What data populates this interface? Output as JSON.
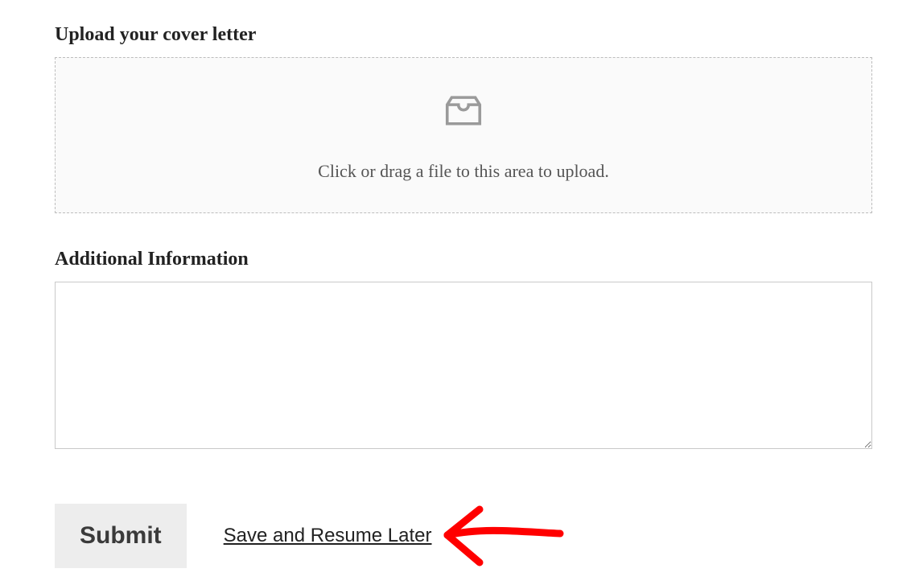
{
  "cover_letter": {
    "label": "Upload your cover letter",
    "dropzone_text": "Click or drag a file to this area to upload."
  },
  "additional": {
    "label": "Additional Information",
    "value": ""
  },
  "actions": {
    "submit_label": "Submit",
    "save_resume_label": "Save and Resume Later"
  },
  "annotation": {
    "arrow_color": "#ff0000"
  }
}
